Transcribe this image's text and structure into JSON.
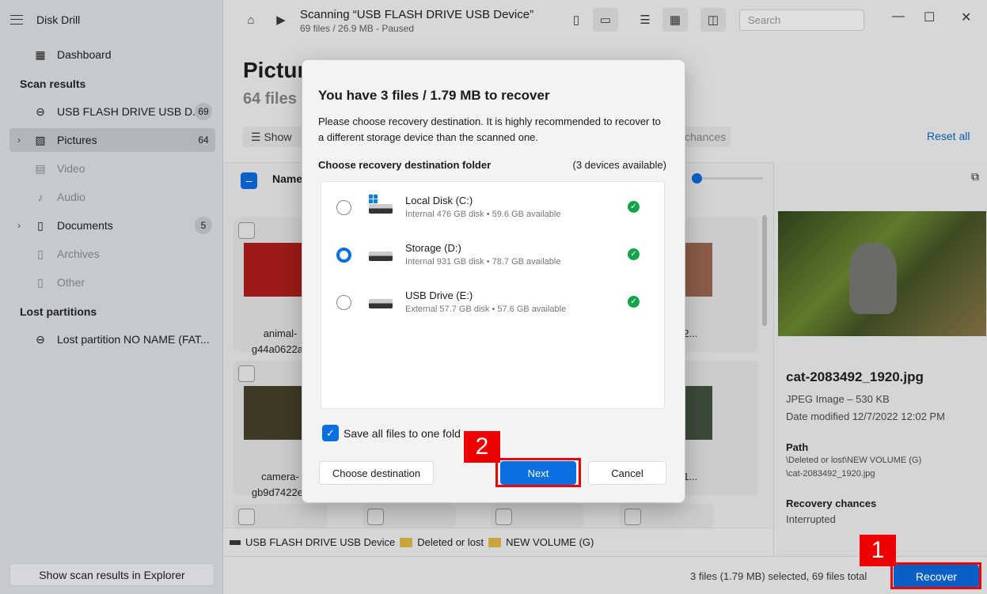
{
  "app": {
    "title": "Disk Drill"
  },
  "sidebar": {
    "dashboard": "Dashboard",
    "scan_results_heading": "Scan results",
    "items": [
      {
        "label": "USB FLASH DRIVE USB D...",
        "count": "69"
      },
      {
        "label": "Pictures",
        "count": "64"
      },
      {
        "label": "Video"
      },
      {
        "label": "Audio"
      },
      {
        "label": "Documents",
        "count": "5"
      },
      {
        "label": "Archives"
      },
      {
        "label": "Other"
      }
    ],
    "lost_partitions_heading": "Lost partitions",
    "lost_partition": "Lost partition NO NAME (FAT...",
    "show_explorer": "Show scan results in Explorer"
  },
  "topbar": {
    "scan_title": "Scanning “USB FLASH DRIVE USB Device”",
    "scan_sub": "69 files / 26.9 MB - Paused",
    "search_placeholder": "Search"
  },
  "main": {
    "title": "Pictur",
    "subtitle": "64 files /",
    "show_label": "Show",
    "chances_label": "chances",
    "reset_all": "Reset all",
    "name_column": "Name",
    "tiles": [
      {
        "name1": "animal-",
        "name2": "g44a0622a0"
      },
      {
        "name1": "camera-",
        "name2": "gb9d7422e2"
      },
      {
        "name1": "242..."
      },
      {
        "name1": "4_1..."
      }
    ]
  },
  "breadcrumb": [
    "USB FLASH DRIVE USB Device",
    "Deleted or lost",
    "NEW VOLUME (G)"
  ],
  "preview": {
    "filename": "cat-2083492_1920.jpg",
    "type": "JPEG Image – 530 KB",
    "modified": "Date modified 12/7/2022 12:02 PM",
    "path_label": "Path",
    "path1": "\\Deleted or lost\\NEW VOLUME (G)",
    "path2": "\\cat-2083492_1920.jpg",
    "chances_label": "Recovery chances",
    "chances_value": "Interrupted"
  },
  "footer": {
    "selection": "3 files (1.79 MB) selected, 69 files total",
    "recover": "Recover"
  },
  "annotations": {
    "one": "1",
    "two": "2"
  },
  "dialog": {
    "title": "You have 3 files / 1.79 MB to recover",
    "description": "Please choose recovery destination. It is highly recommended to recover to a different storage device than the scanned one.",
    "folder_label": "Choose recovery destination folder",
    "devices_count": "(3 devices available)",
    "devices": [
      {
        "name": "Local Disk (C:)",
        "desc": "Internal 476 GB disk • 59.6 GB available",
        "selected": false
      },
      {
        "name": "Storage (D:)",
        "desc": "Internal 931 GB disk • 78.7 GB available",
        "selected": true
      },
      {
        "name": "USB Drive (E:)",
        "desc": "External 57.7 GB disk • 57.6 GB available",
        "selected": false
      }
    ],
    "save_one_folder": "Save all files to one fold",
    "save_checked": true,
    "choose_destination": "Choose destination",
    "next": "Next",
    "cancel": "Cancel"
  },
  "colors": {
    "accent": "#0a6fe0",
    "annotation": "#ee0000",
    "ok": "#14a34a"
  }
}
